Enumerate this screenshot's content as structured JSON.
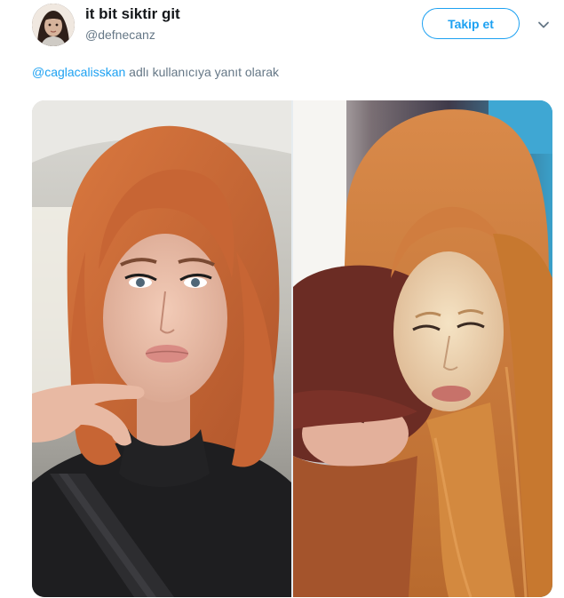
{
  "tweet": {
    "display_name": "it bit siktir git",
    "handle": "@defnecanz",
    "follow_label": "Takip et",
    "reply": {
      "mention": "@caglacalisskan",
      "text": " adlı kullanıcıya yanıt olarak"
    },
    "media_count": 2
  },
  "icons": {
    "avatar": "avatar-child-photo",
    "menu": "chevron-down-icon"
  },
  "colors": {
    "accent": "#1da1f2",
    "secondary_text": "#657786",
    "primary_text": "#14171a"
  }
}
